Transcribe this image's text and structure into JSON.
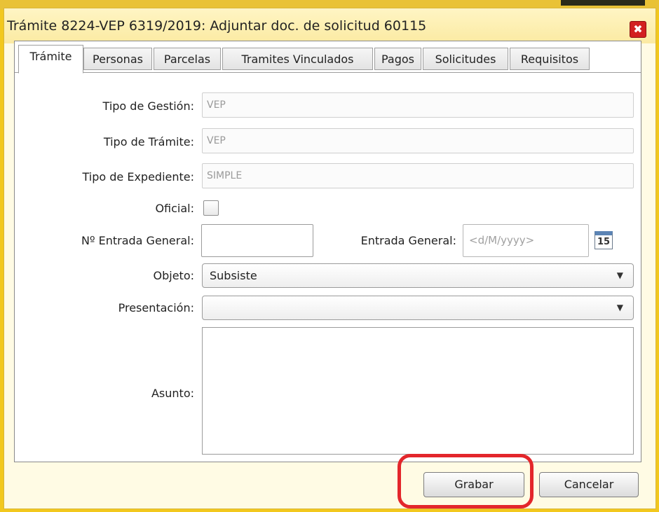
{
  "window": {
    "title": "Trámite 8224-VEP 6319/2019: Adjuntar doc. de solicitud 60115",
    "close_label": "✖"
  },
  "tabs": [
    {
      "label": "Trámite",
      "active": true
    },
    {
      "label": "Personas"
    },
    {
      "label": "Parcelas"
    },
    {
      "label": "Tramites Vinculados"
    },
    {
      "label": "Pagos"
    },
    {
      "label": "Solicitudes"
    },
    {
      "label": "Requisitos"
    }
  ],
  "form": {
    "tipo_gestion": {
      "label": "Tipo de Gestión:",
      "value": "VEP"
    },
    "tipo_tramite": {
      "label": "Tipo de Trámite:",
      "value": "VEP"
    },
    "tipo_expediente": {
      "label": "Tipo de Expediente:",
      "value": "SIMPLE"
    },
    "oficial": {
      "label": "Oficial:",
      "checked": false
    },
    "nro_entrada": {
      "label": "Nº Entrada General:",
      "value": ""
    },
    "entrada_general": {
      "label": "Entrada General:",
      "placeholder": "<d/M/yyyy>",
      "calendar_day": "15"
    },
    "objeto": {
      "label": "Objeto:",
      "value": "Subsiste"
    },
    "presentacion": {
      "label": "Presentación:",
      "value": ""
    },
    "asunto": {
      "label": "Asunto:",
      "value": ""
    }
  },
  "buttons": {
    "save": "Grabar",
    "cancel": "Cancelar"
  },
  "colors": {
    "highlight": "#e3262b",
    "close": "#d22020",
    "background": "#f2c81e"
  },
  "dropdown_arrow": "▼"
}
